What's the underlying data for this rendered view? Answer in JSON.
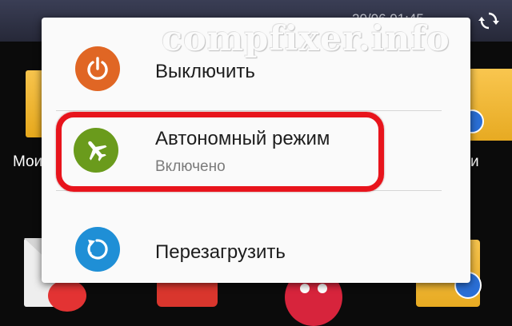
{
  "status_bar": {
    "time": "20/06 01:45",
    "sync_icon": "sync-icon"
  },
  "background_labels": {
    "left": "Мои",
    "right": "и"
  },
  "watermark": "compfixer.info",
  "power_menu": {
    "items": [
      {
        "label": "Выключить",
        "icon": "power-icon",
        "color": "#e06624"
      },
      {
        "label": "Автономный режим",
        "sublabel": "Включено",
        "icon": "airplane-icon",
        "color": "#6a9b1c"
      },
      {
        "label": "Перезагрузить",
        "icon": "restart-icon",
        "color": "#1f8fd6"
      }
    ],
    "highlight_color": "#e8141c"
  }
}
